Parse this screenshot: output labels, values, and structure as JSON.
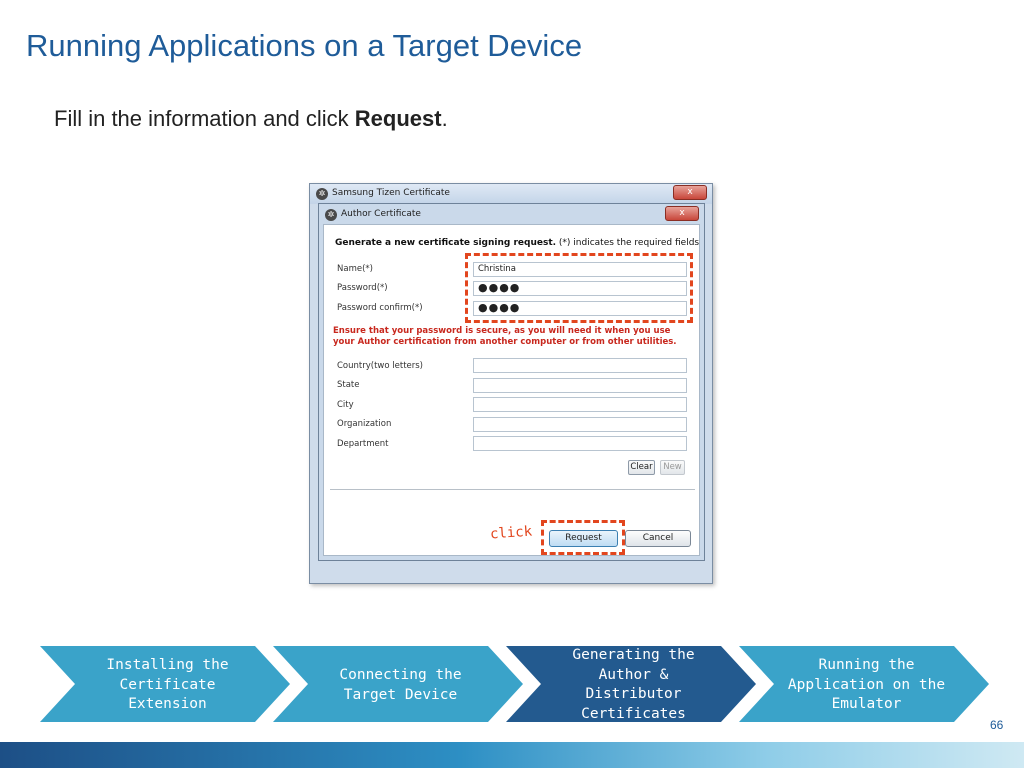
{
  "slide": {
    "title": "Running Applications on a Target Device",
    "instruction_prefix": "Fill in the information and click ",
    "instruction_action": "Request",
    "instruction_suffix": ".",
    "page_number": "66"
  },
  "outer_dialog": {
    "title": "Samsung Tizen Certificate",
    "close_label": "x"
  },
  "inner_dialog": {
    "title": "Author Certificate",
    "close_label": "x",
    "heading_bold": "Generate a new certificate signing request.",
    "heading_rest": " (*) indicates the required fields",
    "fields": [
      {
        "label": "Name(*)",
        "value": "Christina"
      },
      {
        "label": "Password(*)",
        "value": "●●●●"
      },
      {
        "label": "Password confirm(*)",
        "value": "●●●●"
      }
    ],
    "warning": "Ensure that your password is secure, as you will need it when you use your Author certification from another computer or from other utilities.",
    "optional_fields": [
      {
        "label": "Country(two letters)",
        "value": ""
      },
      {
        "label": "State",
        "value": ""
      },
      {
        "label": "City",
        "value": ""
      },
      {
        "label": "Organization",
        "value": ""
      },
      {
        "label": "Department",
        "value": ""
      }
    ],
    "clear_label": "Clear",
    "new_label": "New",
    "request_label": "Request",
    "cancel_label": "Cancel"
  },
  "annotation": {
    "click_note": "click",
    "highlight_color": "#e2461e"
  },
  "process_steps": [
    {
      "label_lines": [
        "Installing the",
        "Certificate",
        "Extension"
      ],
      "color": "#3aa3c9"
    },
    {
      "label_lines": [
        "Connecting the",
        "Target Device"
      ],
      "color": "#3aa3c9"
    },
    {
      "label_lines": [
        "Generating the",
        "Author &",
        "Distributor",
        "Certificates"
      ],
      "color": "#235a8f"
    },
    {
      "label_lines": [
        "Running the",
        "Application on the",
        "Emulator"
      ],
      "color": "#3aa3c9"
    }
  ]
}
